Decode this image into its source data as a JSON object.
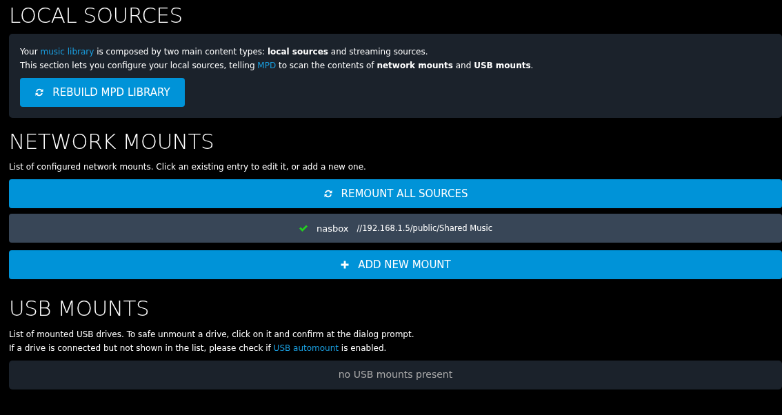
{
  "local_sources": {
    "title": "LOCAL SOURCES",
    "paragraphs": [
      [
        {
          "kind": "text",
          "text": "Your "
        },
        {
          "kind": "link",
          "text": "music library"
        },
        {
          "kind": "text",
          "text": " is composed by two main content types: **local sources** and streaming sources."
        }
      ],
      [
        {
          "kind": "text",
          "text": "This section lets you configure your local sources, telling "
        },
        {
          "kind": "link",
          "text": "MPD"
        },
        {
          "kind": "text",
          "text": " to scan the contents of **network mounts** and **USB mounts**."
        }
      ]
    ],
    "button": {
      "label": "REBUILD MPD LIBRARY"
    }
  },
  "network_mounts": {
    "title": "NETWORK MOUNTS",
    "paragraphs": [
      [
        {
          "kind": "text",
          "text": "List of configured network mounts. Click an existing entry to edit it, or add a new one."
        }
      ]
    ],
    "remount_button": {
      "label": "REMOUNT ALL SOURCES"
    },
    "mounts": [
      {
        "mounted": true,
        "name": "nasbox",
        "path": "//192.168.1.5/public/Shared Music"
      }
    ],
    "add_button": {
      "label": "ADD NEW MOUNT"
    }
  },
  "usb_mounts": {
    "title": "USB MOUNTS",
    "paragraphs": [
      [
        {
          "kind": "text",
          "text": "List of mounted USB drives. To safe unmount a drive, click on it and confirm at the dialog prompt."
        }
      ],
      [
        {
          "kind": "text",
          "text": "If a drive is connected but not shown in the list, please check if "
        },
        {
          "kind": "link",
          "text": "USB automount"
        },
        {
          "kind": "text",
          "text": " is enabled."
        }
      ]
    ],
    "empty_message": "no USB mounts present"
  }
}
